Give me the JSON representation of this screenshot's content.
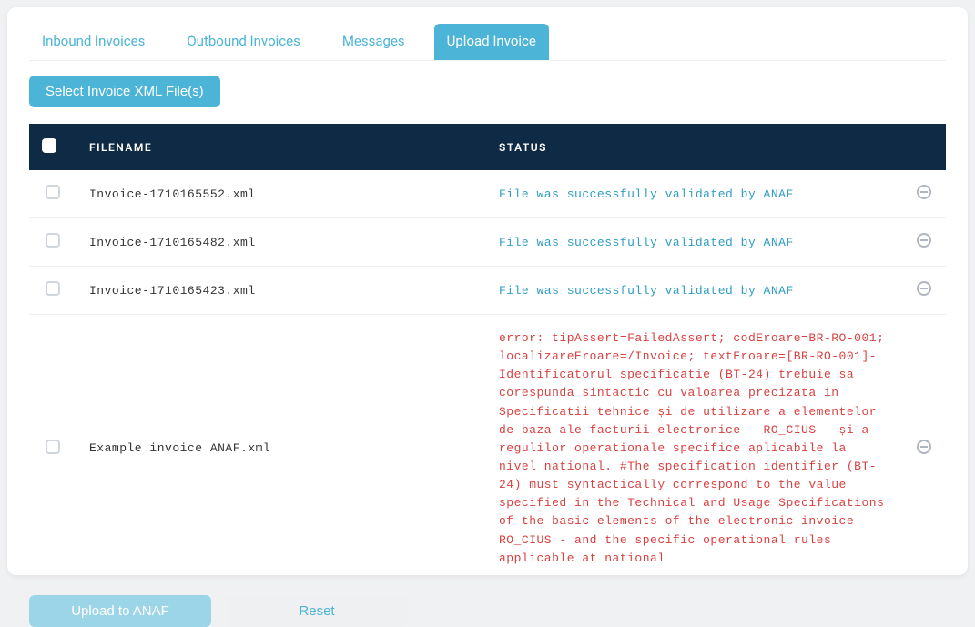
{
  "tabs": {
    "inbound": "Inbound Invoices",
    "outbound": "Outbound Invoices",
    "messages": "Messages",
    "upload": "Upload Invoice"
  },
  "buttons": {
    "select_files": "Select Invoice XML File(s)",
    "upload": "Upload to ANAF",
    "reset": "Reset"
  },
  "table": {
    "headers": {
      "filename": "FILENAME",
      "status": "STATUS"
    },
    "rows": [
      {
        "filename": "Invoice-1710165552.xml",
        "status": "File was successfully validated by ANAF",
        "ok": true
      },
      {
        "filename": "Invoice-1710165482.xml",
        "status": "File was successfully validated by ANAF",
        "ok": true
      },
      {
        "filename": "Invoice-1710165423.xml",
        "status": "File was successfully validated by ANAF",
        "ok": true
      },
      {
        "filename": "Example invoice ANAF.xml",
        "status": "error: tipAssert=FailedAssert; codEroare=BR-RO-001; localizareEroare=/Invoice; textEroare=[BR-RO-001]-Identificatorul specificatie (BT-24) trebuie sa corespunda sintactic cu valoarea precizata in Specificatii tehnice și de utilizare a elementelor de baza ale facturii electronice - RO_CIUS - și a regulilor operationale specifice aplicabile la nivel national. #The specification identifier (BT-24) must syntactically correspond to the value specified in the Technical and Usage Specifications of the basic elements of the electronic invoice - RO_CIUS - and the specific operational rules applicable at national",
        "ok": false
      }
    ]
  },
  "colors": {
    "accent": "#4cb4d6",
    "header_bg": "#0f2a44",
    "error": "#d84040"
  }
}
